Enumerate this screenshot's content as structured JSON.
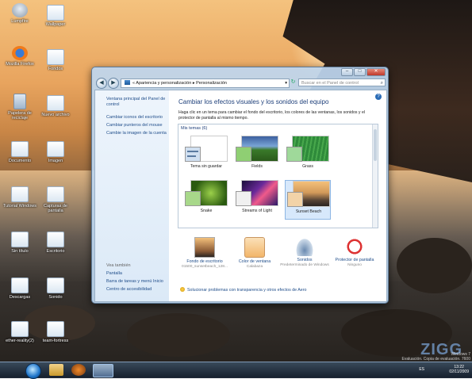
{
  "desktop": {
    "icons": [
      {
        "label": "Lumpfire",
        "kind": "rec"
      },
      {
        "label": "Wallpaper",
        "kind": "file"
      },
      {
        "label": "Mozilla Firefox",
        "kind": "ff"
      },
      {
        "label": "Fondos",
        "kind": "file"
      },
      {
        "label": "Papelera de reciclaje",
        "kind": "bin"
      },
      {
        "label": "Nuevo archivo",
        "kind": "file"
      },
      {
        "label": "Documento",
        "kind": "file"
      },
      {
        "label": "Imagen",
        "kind": "file"
      },
      {
        "label": "Tutorial Windows",
        "kind": "file"
      },
      {
        "label": "Capturas de pantalla",
        "kind": "file"
      },
      {
        "label": "Sin título",
        "kind": "file"
      },
      {
        "label": "Escritorio",
        "kind": "file"
      },
      {
        "label": "Descargas",
        "kind": "file"
      },
      {
        "label": "Sonido",
        "kind": "file"
      },
      {
        "label": "ether-reality(2)",
        "kind": "file"
      },
      {
        "label": "team-fortress",
        "kind": "file"
      }
    ]
  },
  "window": {
    "minimize": "–",
    "maximize": "□",
    "close": "✕",
    "back": "◀",
    "forward": "▶",
    "address": "« Apariencia y personalización  ▸  Personalización",
    "address_arrow": "▾",
    "refresh": "↻",
    "search_placeholder": "Buscar en el Panel de control",
    "search_icon": "search-icon",
    "left": {
      "home": "Ventana principal del Panel de control",
      "links": [
        "Cambiar iconos del escritorio",
        "Cambiar punteros del mouse",
        "Cambie la imagen de la cuenta"
      ],
      "see_also_title": "Vea también",
      "see_also": [
        "Pantalla",
        "Barra de tareas y menú Inicio",
        "Centro de accesibilidad"
      ]
    },
    "help": "?",
    "heading": "Cambiar los efectos visuales y los sonidos del equipo",
    "description": "Haga clic en un tema para cambiar el fondo del escritorio, los colores de las ventanas, los sonidos y el protector de pantalla al mismo tiempo.",
    "my_themes": "Mis temas (6)",
    "themes": [
      {
        "label": "Tema sin guardar",
        "thumb": "#ffffff",
        "color": "#d0dff0",
        "selected": false
      },
      {
        "label": "Fields",
        "thumb": "#3a7a2a",
        "color": "#8fcf73",
        "selected": false
      },
      {
        "label": "Grass",
        "thumb": "#2e8a3a",
        "color": "#9fd99a",
        "selected": false
      },
      {
        "label": "Snake",
        "thumb": "#4a8a22",
        "color": "#a8d88a",
        "selected": false
      },
      {
        "label": "Streams of Light",
        "thumb": "#2a1a6a",
        "color": "#f0f0f0",
        "selected": false
      },
      {
        "label": "Sunset Beach",
        "thumb": "#d39a5a",
        "color": "#f2d3a8",
        "selected": true
      }
    ],
    "bottom": [
      {
        "title": "Fondo de escritorio",
        "sub": "01500_sunsetbeach_128...",
        "icon": "wallpaper-icon"
      },
      {
        "title": "Color de ventana",
        "sub": "Calabaza",
        "icon": "window-color-icon"
      },
      {
        "title": "Sonidos",
        "sub": "Predeterminado de Windows",
        "icon": "sounds-icon"
      },
      {
        "title": "Protector de pantalla",
        "sub": "Ninguno",
        "icon": "screensaver-icon"
      }
    ],
    "troubleshoot": "Solucionar problemas con transparencia y otros efectos de Aero"
  },
  "taskbar": {
    "lang": "ES",
    "time": "13:22",
    "date": "02/11/2009"
  },
  "watermark": {
    "logo": "ZIGG",
    "line1": "Windows 7",
    "line2": "Evaluación. Copia de evaluación. 7600"
  },
  "colors": {
    "accent": "#1e3f7a",
    "link": "#1f4d8a"
  }
}
